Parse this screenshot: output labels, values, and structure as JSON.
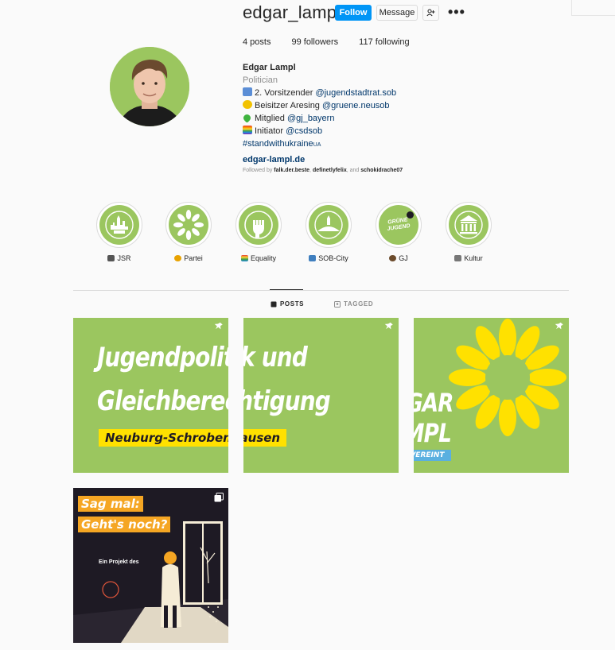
{
  "profile": {
    "username": "edgar_lampl",
    "follow_label": "Follow",
    "message_label": "Message",
    "stats": {
      "posts": "4 posts",
      "followers": "99 followers",
      "following": "117 following"
    },
    "name": "Edgar Lampl",
    "category": "Politician",
    "bio": [
      {
        "icon": "city-icon",
        "text": "2. Vorsitzender ",
        "link": "@jugendstadtrat.sob"
      },
      {
        "icon": "sunflower-icon",
        "text": "Beisitzer Aresing ",
        "link": "@gruene.neusob"
      },
      {
        "icon": "green-heart-icon",
        "text": "Mitglied ",
        "link": "@gj_bayern"
      },
      {
        "icon": "rainbow-icon",
        "text": "Initiator ",
        "link": "@csdsob"
      }
    ],
    "hashtag": "#standwithukraine",
    "hashtag_suffix": "UA",
    "website": "edgar-lampl.de",
    "followed_by_prefix": "Followed by ",
    "followed_by": [
      "falk.der.beste",
      "definetlyfelix",
      "schokidrache07"
    ],
    "followed_sep": ", ",
    "followed_and": ", and "
  },
  "highlights": [
    {
      "label": "JSR",
      "icon": "city-skyline-icon",
      "emoji_color": "#555555"
    },
    {
      "label": "Partei",
      "icon": "sunflower-icon",
      "emoji_color": "#e8a200"
    },
    {
      "label": "Equality",
      "icon": "raised-fist-icon",
      "emoji_color": "#e44d26"
    },
    {
      "label": "SOB-City",
      "icon": "town-icon",
      "emoji_color": "#3f7fbf"
    },
    {
      "label": "GJ",
      "icon": "gruene-jugend-logo-icon",
      "emoji_color": "#6b4a2b"
    },
    {
      "label": "Kultur",
      "icon": "museum-icon",
      "emoji_color": "#777777"
    }
  ],
  "gj_logo_text": [
    "GRÜNE",
    "JUGEND"
  ],
  "tabs": {
    "posts": "POSTS",
    "tagged": "TAGGED"
  },
  "posts": {
    "p1_p2_line1": "Jugendpolitik und",
    "p1_p2_line2": "Gleichberechtigung",
    "p1_p2_banner": "Neuburg-Schrobenhausen",
    "p3_line1": "EDGAR",
    "p3_line2": "LAMPL",
    "p3_banner": "#ALLESVEREINT",
    "p4_line1": "Sag mal:",
    "p4_line2": "Geht's noch?",
    "p4_small": "Ein Projekt des"
  },
  "colors": {
    "accent": "#0095f6",
    "green": "#9bc65f",
    "yellow": "#ffe100",
    "dark": "#1e1a24",
    "blue_banner": "#5ab0e0"
  }
}
